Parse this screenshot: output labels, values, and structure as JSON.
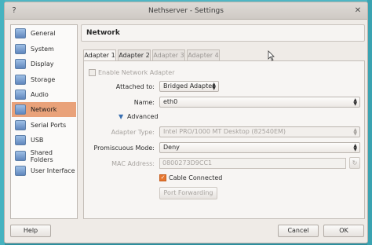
{
  "window": {
    "title": "Nethserver - Settings"
  },
  "titlebar_icons": {
    "menu": "?",
    "close": "✕"
  },
  "sidebar": {
    "items": [
      {
        "label": "General",
        "icon": "general-icon"
      },
      {
        "label": "System",
        "icon": "system-icon"
      },
      {
        "label": "Display",
        "icon": "display-icon"
      },
      {
        "label": "Storage",
        "icon": "storage-icon"
      },
      {
        "label": "Audio",
        "icon": "audio-icon"
      },
      {
        "label": "Network",
        "icon": "network-icon"
      },
      {
        "label": "Serial Ports",
        "icon": "serial-ports-icon"
      },
      {
        "label": "USB",
        "icon": "usb-icon"
      },
      {
        "label": "Shared Folders",
        "icon": "shared-folders-icon"
      },
      {
        "label": "User Interface",
        "icon": "user-interface-icon"
      }
    ],
    "selected": "Network"
  },
  "main": {
    "heading": "Network",
    "tabs": [
      "Adapter 1",
      "Adapter 2",
      "Adapter 3",
      "Adapter 4"
    ],
    "active_tab": "Adapter 1",
    "enable_label": "Enable Network Adapter",
    "attached_label": "Attached to:",
    "attached_value": "Bridged Adapter",
    "name_label": "Name:",
    "name_value": "eth0",
    "advanced_label": "Advanced",
    "adapter_type_label": "Adapter Type:",
    "adapter_type_value": "Intel PRO/1000 MT Desktop (82540EM)",
    "promiscuous_label": "Promiscuous Mode:",
    "promiscuous_value": "Deny",
    "mac_label": "MAC Address:",
    "mac_value": "0800273D9CC1",
    "cable_label": "Cable Connected",
    "cable_connected": true,
    "port_forwarding_label": "Port Forwarding"
  },
  "footer": {
    "help_label": "Help",
    "cancel_label": "Cancel",
    "ok_label": "OK"
  },
  "colors": {
    "selection": "#e9a27a",
    "checkbox_on": "#e5762f",
    "desktop": "#3aa3b1"
  }
}
